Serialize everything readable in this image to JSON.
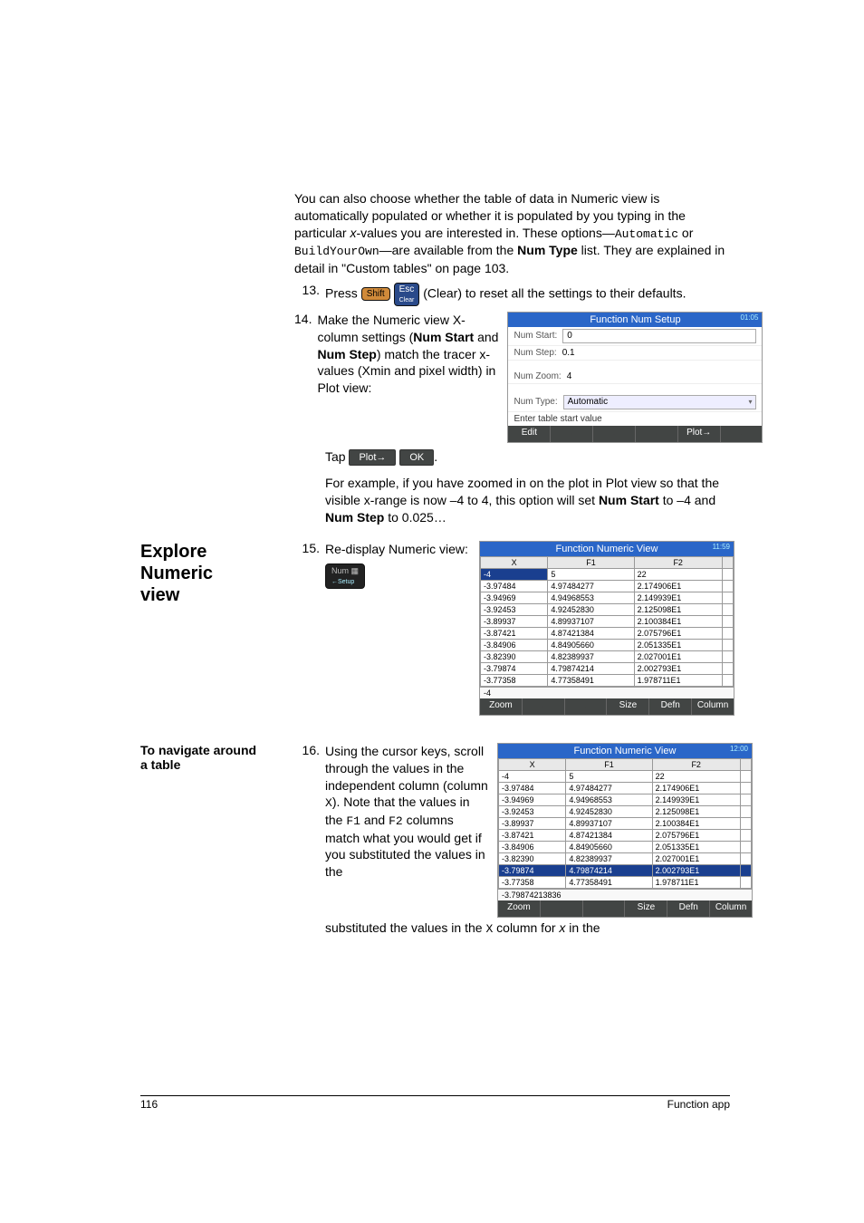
{
  "body": {
    "intro_p1": "You can also choose whether the table of data in Numeric view is automatically populated or whether it is populated by you typing in the particular ",
    "intro_xvalues": "x",
    "intro_p1b": "-values you are interested in. These options—",
    "code_auto": "Automatic",
    "intro_or": " or ",
    "code_byo": "BuildYourOwn",
    "intro_p1c": "—are available from the ",
    "bold_numtype": "Num Type",
    "intro_p1d": " list. They are explained in detail in \"Custom tables\" on page 103."
  },
  "step13": {
    "num": "13.",
    "pre": "Press ",
    "key_shift": "Shift",
    "key_esc": "Esc",
    "key_clear": "Clear",
    "post": " (Clear) to reset all the settings to their defaults."
  },
  "step14": {
    "num": "14.",
    "text_a": "Make the Numeric view X-column settings (",
    "bold_numstart": "Num Start",
    "and": " and ",
    "bold_numstep": "Num Step",
    "text_b": ") match the tracer x-values (Xmin and pixel width) in Plot view:",
    "tap": "Tap ",
    "btn_plot": "Plot→",
    "btn_ok": "OK",
    "period": "."
  },
  "step14_post": {
    "text_a": "For example, if you have zoomed in on the plot in Plot view so that the visible x-range is now –4 to 4, this option will set ",
    "bold1": "Num Start",
    "mid": " to –4 and ",
    "bold2": "Num Step",
    "text_b": " to 0.025…"
  },
  "side_explore": {
    "l1": "Explore",
    "l2": "Numeric",
    "l3": "view"
  },
  "step15": {
    "num": "15.",
    "text": "Re-display Numeric view:",
    "key_num_top": "Num",
    "key_num_bot": "←Setup"
  },
  "side_navigate": {
    "l1": "To navigate around",
    "l2": "a table"
  },
  "step16": {
    "num": "16.",
    "text_a": "Using the cursor keys, scroll through the values in the independent column (column ",
    "code_x": "X",
    "text_b": "). Note that the values in the ",
    "code_f1": "F1",
    "and": " and ",
    "code_f2": "F2",
    "text_c": " columns match what you would get if you substituted the values in the ",
    "code_x2": "X",
    "text_d": " column for ",
    "ital_x": "x",
    "text_e": " in the"
  },
  "calc1": {
    "title": "Function Num Setup",
    "time": "01:05",
    "start_lbl": "Num Start:",
    "start_val": "0",
    "step_lbl": "Num Step:",
    "step_val": "0.1",
    "zoom_lbl": "Num Zoom:",
    "zoom_val": "4",
    "type_lbl": "Num Type:",
    "type_val": "Automatic",
    "msg": "Enter table start value",
    "sb_edit": "Edit",
    "sb_plot": "Plot→"
  },
  "calc23_common": {
    "title": "Function Numeric View",
    "cols": [
      "X",
      "F1",
      "F2",
      ""
    ],
    "sb_zoom": "Zoom",
    "sb_size": "Size",
    "sb_defn": "Defn",
    "sb_column": "Column"
  },
  "calc2": {
    "time": "11:59",
    "rows": [
      [
        "-4",
        "5",
        "22",
        ""
      ],
      [
        "-3.97484",
        "4.97484277",
        "2.174906E1",
        ""
      ],
      [
        "-3.94969",
        "4.94968553",
        "2.149939E1",
        ""
      ],
      [
        "-3.92453",
        "4.92452830",
        "2.125098E1",
        ""
      ],
      [
        "-3.89937",
        "4.89937107",
        "2.100384E1",
        ""
      ],
      [
        "-3.87421",
        "4.87421384",
        "2.075796E1",
        ""
      ],
      [
        "-3.84906",
        "4.84905660",
        "2.051335E1",
        ""
      ],
      [
        "-3.82390",
        "4.82389937",
        "2.027001E1",
        ""
      ],
      [
        "-3.79874",
        "4.79874214",
        "2.002793E1",
        ""
      ],
      [
        "-3.77358",
        "4.77358491",
        "1.978711E1",
        ""
      ]
    ],
    "readout": "-4"
  },
  "calc3": {
    "time": "12:00",
    "rows": [
      [
        "-4",
        "5",
        "22",
        ""
      ],
      [
        "-3.97484",
        "4.97484277",
        "2.174906E1",
        ""
      ],
      [
        "-3.94969",
        "4.94968553",
        "2.149939E1",
        ""
      ],
      [
        "-3.92453",
        "4.92452830",
        "2.125098E1",
        ""
      ],
      [
        "-3.89937",
        "4.89937107",
        "2.100384E1",
        ""
      ],
      [
        "-3.87421",
        "4.87421384",
        "2.075796E1",
        ""
      ],
      [
        "-3.84906",
        "4.84905660",
        "2.051335E1",
        ""
      ],
      [
        "-3.82390",
        "4.82389937",
        "2.027001E1",
        ""
      ],
      [
        "-3.79874",
        "4.79874214",
        "2.002793E1",
        ""
      ],
      [
        "-3.77358",
        "4.77358491",
        "1.978711E1",
        ""
      ]
    ],
    "readout": "-3.79874213836"
  },
  "footer": {
    "page": "116",
    "title": "Function app"
  }
}
